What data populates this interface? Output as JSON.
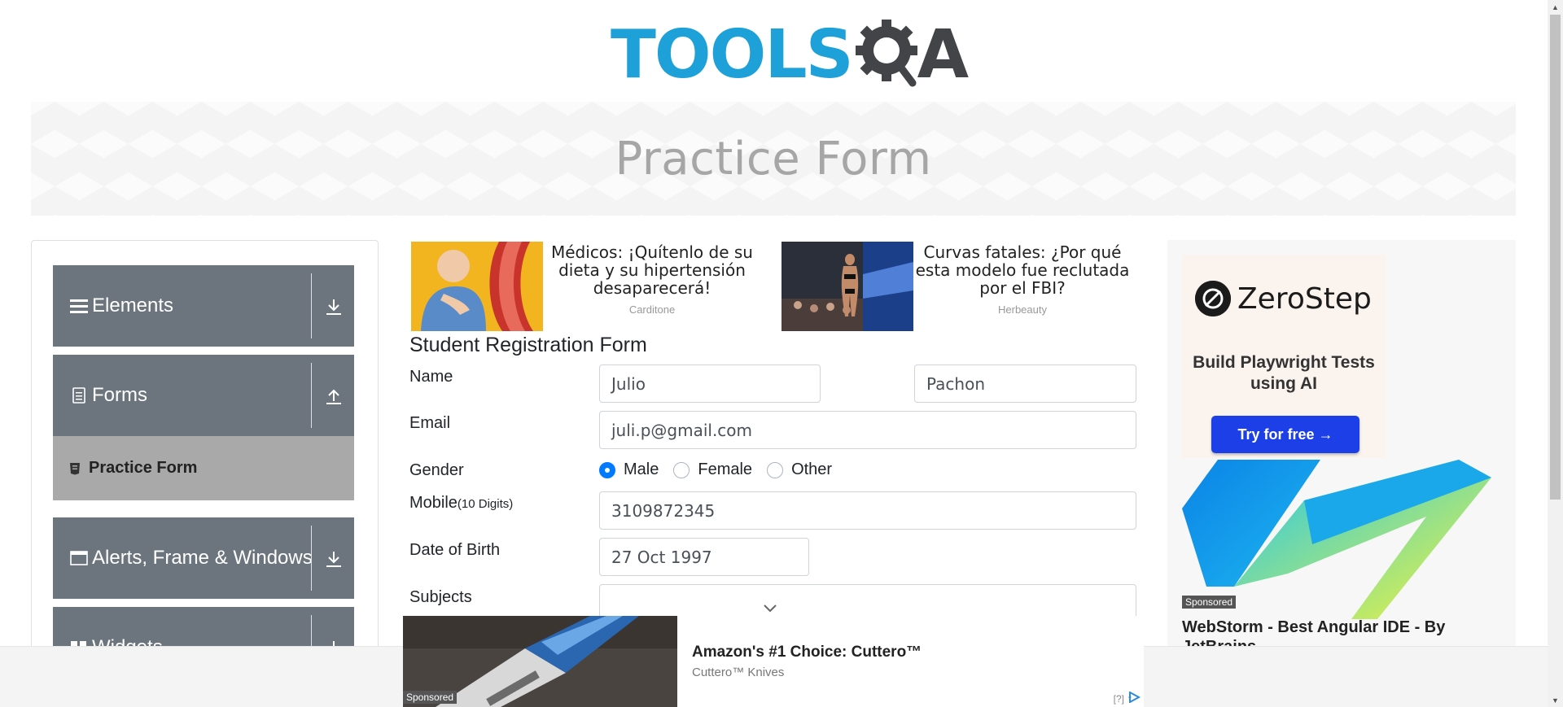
{
  "header": {
    "logo_text": "TOOLS",
    "logo_suffix": "A"
  },
  "banner": {
    "title": "Practice Form"
  },
  "sidebar": {
    "groups": [
      {
        "label": "Elements",
        "icon": "menu-icon",
        "arrow": "download-icon"
      },
      {
        "label": "Forms",
        "icon": "document-icon",
        "arrow": "upload-icon"
      },
      {
        "label": "Alerts, Frame & Windows",
        "icon": "window-icon",
        "arrow": "download-icon"
      },
      {
        "label": "Widgets",
        "icon": "widgets-icon",
        "arrow": "download-icon"
      }
    ],
    "active_item": {
      "label": "Practice Form",
      "icon": "form-icon"
    }
  },
  "top_ads": [
    {
      "title": "Médicos: ¡Quítenlo de su dieta y su hipertensión desaparecerá!",
      "source": "Carditone"
    },
    {
      "title": "Curvas fatales: ¿Por qué esta modelo fue reclutada por el FBI?",
      "source": "Herbeauty"
    }
  ],
  "form": {
    "title": "Student Registration Form",
    "name_label": "Name",
    "first_name": "Julio",
    "last_name": "Pachon",
    "email_label": "Email",
    "email": "juli.p@gmail.com",
    "gender_label": "Gender",
    "gender_options": [
      "Male",
      "Female",
      "Other"
    ],
    "gender_selected": "Male",
    "mobile_label": "Mobile",
    "mobile_hint": "(10 Digits)",
    "mobile": "3109872345",
    "dob_label": "Date of Birth",
    "dob": "27 Oct 1997",
    "subjects_label": "Subjects"
  },
  "right_ad": {
    "brand": "ZeroStep",
    "tagline": "Build Playwright Tests using AI",
    "cta": "Try for free →",
    "sponsored": "Sponsored",
    "title": "WebStorm - Best Angular IDE - By JetBrains"
  },
  "bottom_ad": {
    "sponsored": "Sponsored",
    "title": "Amazon's #1 Choice: Cuttero™",
    "source": "Cuttero™ Knives",
    "info": "[?]"
  },
  "colors": {
    "brand_blue": "#1ea1d9",
    "sidebar_gray": "#6c757d",
    "active_item_gray": "#a9a9a9",
    "radio_blue": "#007bff",
    "cta_blue": "#1d3fe8"
  }
}
